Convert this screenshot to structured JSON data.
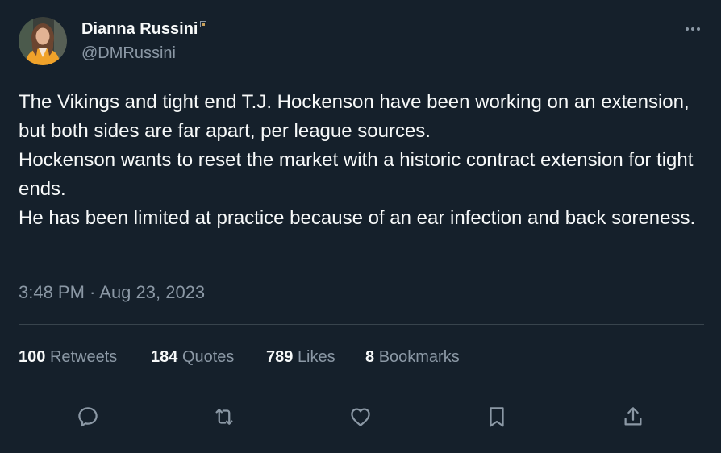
{
  "author": {
    "display_name": "Dianna Russini",
    "handle": "@DMRussini"
  },
  "tweet": {
    "paragraphs": [
      "The Vikings and tight end T.J. Hockenson have been working on an extension, but both sides are far apart, per league sources.",
      "Hockenson wants to reset the market with a historic contract extension for tight ends.",
      "He has been limited at practice because of an ear infection and back soreness."
    ],
    "timestamp": "3:48 PM · Aug 23, 2023"
  },
  "stats": {
    "retweets": {
      "count": "100",
      "label": "Retweets"
    },
    "quotes": {
      "count": "184",
      "label": "Quotes"
    },
    "likes": {
      "count": "789",
      "label": "Likes"
    },
    "bookmarks": {
      "count": "8",
      "label": "Bookmarks"
    }
  },
  "icons": {
    "more": "more-horizontal-icon",
    "reply": "reply-icon",
    "retweet": "retweet-icon",
    "like": "heart-icon",
    "bookmark": "bookmark-icon",
    "share": "share-icon"
  },
  "colors": {
    "background": "#15202b",
    "text_primary": "#f7f9f9",
    "text_secondary": "#8b98a5",
    "divider": "#38444d"
  }
}
